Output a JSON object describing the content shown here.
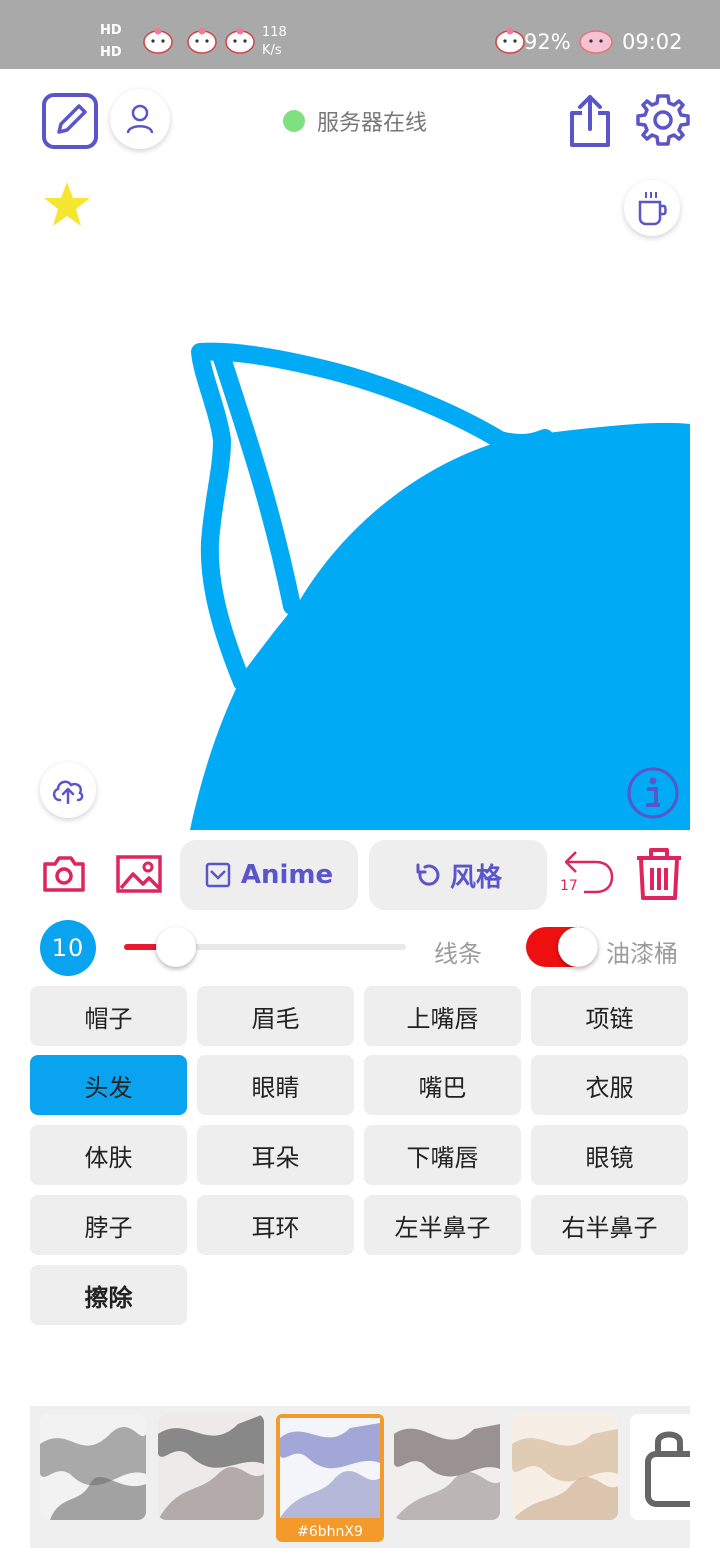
{
  "status_bar": {
    "hd_1": "HD",
    "hd_2": "HD",
    "net_speed_value": "118",
    "net_speed_unit": "K/s",
    "battery": "92%",
    "time": "09:02"
  },
  "header": {
    "server_status": "服务器在线",
    "server_status_color": "#7fe07f"
  },
  "icons": {
    "edit": "edit-icon",
    "user": "user-icon",
    "share": "share-icon",
    "settings": "gear-icon",
    "favorite": "star-icon",
    "coffee": "coffee-icon",
    "upload": "cloud-upload-icon",
    "info": "info-icon",
    "camera": "camera-icon",
    "gallery": "image-icon",
    "undo": "undo-icon",
    "delete": "trash-icon",
    "lock": "lock-icon"
  },
  "tools": {
    "anime_label": "Anime",
    "style_label": "风格",
    "undo_count": "17"
  },
  "brush": {
    "size": "10",
    "line_label": "线条",
    "bucket_label": "油漆桶",
    "bucket_enabled": true
  },
  "parts": [
    {
      "label": "帽子"
    },
    {
      "label": "眉毛"
    },
    {
      "label": "上嘴唇"
    },
    {
      "label": "项链"
    },
    {
      "label": "头发"
    },
    {
      "label": "眼睛"
    },
    {
      "label": "嘴巴"
    },
    {
      "label": "衣服"
    },
    {
      "label": "体肤"
    },
    {
      "label": "耳朵"
    },
    {
      "label": "下嘴唇"
    },
    {
      "label": "眼镜"
    },
    {
      "label": "脖子"
    },
    {
      "label": "耳环"
    },
    {
      "label": "左半鼻子"
    },
    {
      "label": "右半鼻子"
    },
    {
      "label": "擦除"
    }
  ],
  "selected_part": "头发",
  "styles": {
    "selected_code": "#6bhnX9"
  },
  "colors": {
    "accent": "#5a55c9",
    "brush_blue": "#00aaf5",
    "danger": "#e0245e",
    "selected_part_bg": "#0aa3f0",
    "selected_style_bg": "#f39a2b"
  }
}
